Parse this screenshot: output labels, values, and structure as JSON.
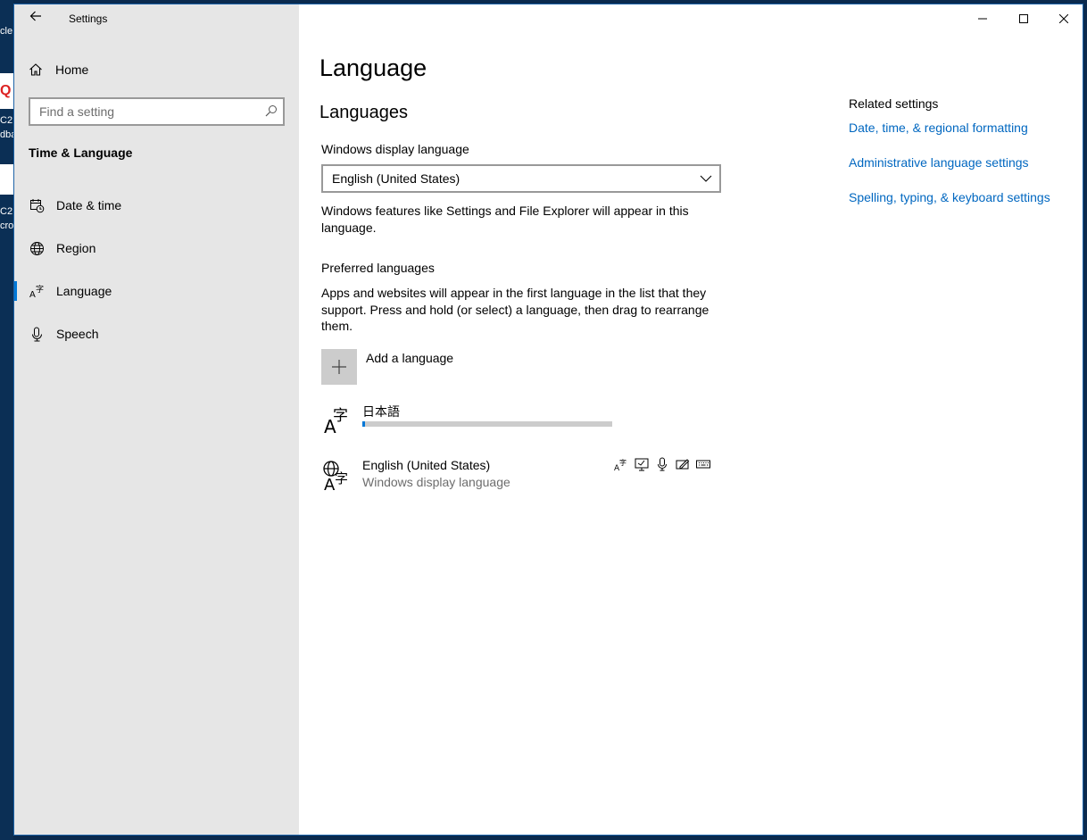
{
  "window": {
    "title": "Settings",
    "controls": [
      "minimize",
      "maximize",
      "close"
    ]
  },
  "desktop": {
    "fragments": [
      "cle",
      "Q",
      "C2",
      "dba",
      "C2",
      "cros"
    ]
  },
  "nav": {
    "home_label": "Home",
    "search_placeholder": "Find a setting",
    "section_title": "Time & Language",
    "items": [
      {
        "label": "Date & time",
        "icon": "calendar-clock-icon",
        "selected": false
      },
      {
        "label": "Region",
        "icon": "globe-icon",
        "selected": false
      },
      {
        "label": "Language",
        "icon": "language-icon",
        "selected": true
      },
      {
        "label": "Speech",
        "icon": "microphone-icon",
        "selected": false
      }
    ]
  },
  "main": {
    "page_title": "Language",
    "section_title": "Languages",
    "display_language_label": "Windows display language",
    "display_language_value": "English (United States)",
    "display_language_note_line1": "Windows features like Settings and File Explorer will appear in this",
    "display_language_note_line2": "language.",
    "preferred_label": "Preferred languages",
    "preferred_desc_line1": "Apps and websites will appear in the first language in the list that they",
    "preferred_desc_line2": "support. Press and hold (or select) a language, then drag to rearrange",
    "preferred_desc_line3": "them.",
    "add_language_label": "Add a language",
    "languages": [
      {
        "name": "日本語",
        "subtitle": "",
        "install_progress": 0.01
      },
      {
        "name": "English (United States)",
        "subtitle": "Windows display language",
        "features": [
          "language-pack-icon",
          "display-text-icon",
          "speech-icon",
          "handwriting-icon",
          "keyboard-icon"
        ]
      }
    ]
  },
  "related": {
    "title": "Related settings",
    "links": [
      "Date, time, & regional formatting",
      "Administrative language settings",
      "Spelling, typing, & keyboard settings"
    ]
  },
  "colors": {
    "accent": "#0078d7",
    "link": "#0067c0",
    "nav_bg": "#e6e6e6",
    "desktop_bg": "#0a2a4e"
  }
}
